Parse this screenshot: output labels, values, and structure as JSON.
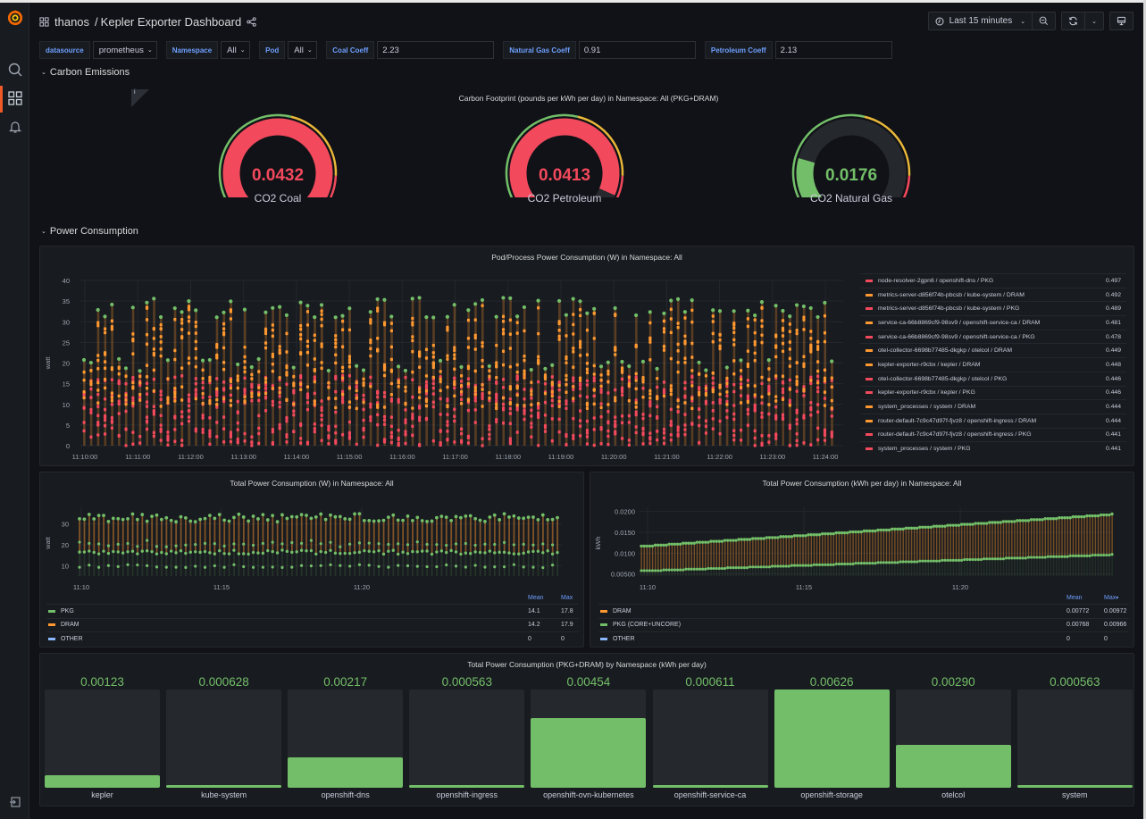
{
  "header": {
    "folder": "thanos",
    "separator": "/",
    "title": "Kepler Exporter Dashboard",
    "time_range": "Last 15 minutes"
  },
  "icons": {
    "logo": "grafana-logo",
    "search": "search-icon",
    "dashboards": "dashboards-icon",
    "alerts": "bell-icon",
    "share": "share-icon",
    "clock": "clock-icon",
    "zoom_out": "zoom-out-icon",
    "refresh": "refresh-icon",
    "tv": "tv-mode-icon"
  },
  "variables": [
    {
      "label": "datasource",
      "value": "prometheus",
      "type": "select"
    },
    {
      "label": "Namespace",
      "value": "All",
      "type": "select"
    },
    {
      "label": "Pod",
      "value": "All",
      "type": "select"
    },
    {
      "label": "Coal Coeff",
      "value": "2.23",
      "type": "input"
    },
    {
      "label": "Natural Gas Coeff",
      "value": "0.91",
      "type": "input"
    },
    {
      "label": "Petroleum Coeff",
      "value": "2.13",
      "type": "input"
    }
  ],
  "rows": {
    "carbon": "Carbon Emissions",
    "power": "Power Consumption"
  },
  "carbon_panel": {
    "title": "Carbon Footprint (pounds per kWh per day) in Namespace: All (PKG+DRAM)",
    "info": "i",
    "gauges": [
      {
        "label": "CO2 Coal",
        "value": "0.0432",
        "fraction": 1.0,
        "color": "#f2495c"
      },
      {
        "label": "CO2 Petroleum",
        "value": "0.0413",
        "fraction": 0.93,
        "color": "#f2495c"
      },
      {
        "label": "CO2 Natural Gas",
        "value": "0.0176",
        "fraction": 0.22,
        "color": "#73bf69"
      }
    ]
  },
  "pod_panel": {
    "title": "Pod/Process Power Consumption (W) in Namespace: All",
    "legend": [
      {
        "name": "node-resolver-2gpn6 / openshift-dns / PKG",
        "value": "0.497",
        "color": "#f2495c"
      },
      {
        "name": "metrics-server-d856f74b-pbcsb / kube-system / DRAM",
        "value": "0.492",
        "color": "#ff9830"
      },
      {
        "name": "metrics-server-d856f74b-pbcsb / kube-system / PKG",
        "value": "0.489",
        "color": "#f2495c"
      },
      {
        "name": "service-ca-66b8869cf9-98sv9 / openshift-service-ca / DRAM",
        "value": "0.481",
        "color": "#ff9830"
      },
      {
        "name": "service-ca-66b8869cf9-98sv9 / openshift-service-ca / PKG",
        "value": "0.478",
        "color": "#f2495c"
      },
      {
        "name": "otel-collector-6698b77485-dkgkp / otelcol / DRAM",
        "value": "0.449",
        "color": "#ff9830"
      },
      {
        "name": "kepler-exporter-r9cbx / kepler / DRAM",
        "value": "0.448",
        "color": "#ff9830"
      },
      {
        "name": "otel-collector-6698b77485-dkgkp / otelcol / PKG",
        "value": "0.446",
        "color": "#f2495c"
      },
      {
        "name": "kepler-exporter-r9cbx / kepler / PKG",
        "value": "0.446",
        "color": "#f2495c"
      },
      {
        "name": "system_processes / system / DRAM",
        "value": "0.444",
        "color": "#ff9830"
      },
      {
        "name": "router-default-7c9c47d97f-fjvz8 / openshift-ingress / DRAM",
        "value": "0.444",
        "color": "#ff9830"
      },
      {
        "name": "router-default-7c9c47d97f-fjvz8 / openshift-ingress / PKG",
        "value": "0.441",
        "color": "#f2495c"
      },
      {
        "name": "system_processes / system / PKG",
        "value": "0.441",
        "color": "#f2495c"
      }
    ]
  },
  "total_w_panel": {
    "title": "Total Power Consumption (W) in Namespace: All",
    "legend_headers": [
      "Mean",
      "Max"
    ],
    "legend": [
      {
        "name": "PKG",
        "mean": "14.1",
        "max": "17.8",
        "color": "#73bf69"
      },
      {
        "name": "DRAM",
        "mean": "14.2",
        "max": "17.9",
        "color": "#ff9830"
      },
      {
        "name": "OTHER",
        "mean": "0",
        "max": "0",
        "color": "#8ab8ff"
      }
    ]
  },
  "total_kwh_panel": {
    "title": "Total Power Consumption (kWh per day) in Namespace: All",
    "legend_headers": [
      "Mean",
      "Max"
    ],
    "sort_indicator": "▾",
    "legend": [
      {
        "name": "DRAM",
        "mean": "0.00772",
        "max": "0.00972",
        "color": "#ff9830"
      },
      {
        "name": "PKG (CORE+UNCORE)",
        "mean": "0.00768",
        "max": "0.00966",
        "color": "#73bf69"
      },
      {
        "name": "OTHER",
        "mean": "0",
        "max": "0",
        "color": "#8ab8ff"
      }
    ]
  },
  "namespace_panel": {
    "title": "Total Power Consumption (PKG+DRAM) by Namespace (kWh per day)",
    "bars": [
      {
        "name": "kepler",
        "value": "0.00123",
        "fraction": 0.13
      },
      {
        "name": "kube-system",
        "value": "0.000628",
        "fraction": 0.03
      },
      {
        "name": "openshift-dns",
        "value": "0.00217",
        "fraction": 0.31
      },
      {
        "name": "openshift-ingress",
        "value": "0.000563",
        "fraction": 0.02
      },
      {
        "name": "openshift-ovn-kubernetes",
        "value": "0.00454",
        "fraction": 0.71
      },
      {
        "name": "openshift-service-ca",
        "value": "0.000611",
        "fraction": 0.03
      },
      {
        "name": "openshift-storage",
        "value": "0.00626",
        "fraction": 1.0
      },
      {
        "name": "otelcol",
        "value": "0.00290",
        "fraction": 0.44
      },
      {
        "name": "system",
        "value": "0.000563",
        "fraction": 0.02
      }
    ]
  },
  "chart_data": [
    {
      "type": "line",
      "title": "Pod/Process Power Consumption (W) in Namespace: All",
      "ylabel": "watt",
      "ylim": [
        0,
        40
      ],
      "yticks": [
        "0",
        "5",
        "10",
        "15",
        "20",
        "25",
        "30",
        "35",
        "40"
      ],
      "xticks": [
        "11:10:00",
        "11:11:00",
        "11:12:00",
        "11:13:00",
        "11:14:00",
        "11:15:00",
        "11:16:00",
        "11:17:00",
        "11:18:00",
        "11:19:00",
        "11:20:00",
        "11:21:00",
        "11:22:00",
        "11:23:00",
        "11:24:00"
      ],
      "stacked": true,
      "series_summary": {
        "total_top_range": [
          31,
          36
        ],
        "mid_range": [
          18,
          21
        ]
      }
    },
    {
      "type": "line",
      "title": "Total Power Consumption (W) in Namespace: All",
      "ylabel": "watt",
      "ylim": [
        5,
        38
      ],
      "yticks": [
        "10",
        "20",
        "30"
      ],
      "xticks": [
        "11:10",
        "11:15",
        "11:20"
      ],
      "series": [
        {
          "name": "PKG",
          "approx_range": [
            15,
            17.8
          ]
        },
        {
          "name": "DRAM",
          "approx_range": [
            14,
            17.9
          ]
        },
        {
          "name": "OTHER",
          "approx_range": [
            0,
            0
          ]
        }
      ]
    },
    {
      "type": "line",
      "title": "Total Power Consumption (kWh per day) in Namespace: All",
      "ylabel": "kWh",
      "ylim": [
        0.0045,
        0.021
      ],
      "yticks": [
        "0.00500",
        "0.0100",
        "0.0150",
        "0.0200"
      ],
      "xticks": [
        "11:10",
        "11:15",
        "11:20"
      ],
      "series": [
        {
          "name": "PKG (CORE+UNCORE)",
          "start": 0.0058,
          "end": 0.0097
        },
        {
          "name": "DRAM (stacked total)",
          "start": 0.0117,
          "end": 0.0194
        }
      ]
    },
    {
      "type": "bar",
      "title": "Total Power Consumption (PKG+DRAM) by Namespace (kWh per day)",
      "categories": [
        "kepler",
        "kube-system",
        "openshift-dns",
        "openshift-ingress",
        "openshift-ovn-kubernetes",
        "openshift-service-ca",
        "openshift-storage",
        "otelcol",
        "system"
      ],
      "values": [
        0.00123,
        0.000628,
        0.00217,
        0.000563,
        0.00454,
        0.000611,
        0.00626,
        0.0029,
        0.000563
      ]
    }
  ]
}
